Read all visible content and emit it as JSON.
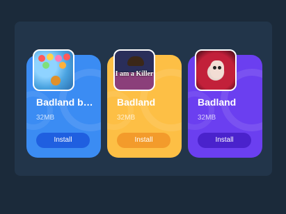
{
  "cards": [
    {
      "title": "Badland b…",
      "size": "32MB",
      "button": "Install",
      "thumb_icon": "bubble-shooter-game-icon",
      "color": "#3b8cf3"
    },
    {
      "title": "Badland",
      "size": "32MB",
      "button": "Install",
      "thumb_icon": "i-am-a-killer-game-icon",
      "thumb_text": "I am a Killer",
      "color": "#fdbf45"
    },
    {
      "title": "Badland",
      "size": "32MB",
      "button": "Install",
      "thumb_icon": "red-hair-girl-game-icon",
      "color": "#6b3ff0"
    }
  ]
}
